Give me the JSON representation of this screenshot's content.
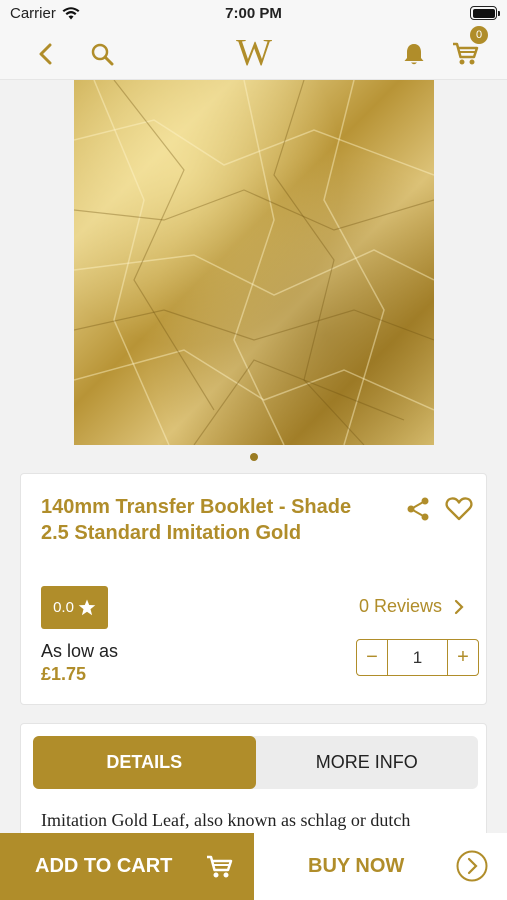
{
  "status_bar": {
    "carrier": "Carrier",
    "time": "7:00 PM"
  },
  "nav": {
    "logo": "W",
    "cart_count": "0",
    "icons": [
      "back-icon",
      "search-icon",
      "bell-icon",
      "cart-icon"
    ]
  },
  "colors": {
    "accent": "#b08d2a",
    "background": "#f2f2f2",
    "card": "#ffffff"
  },
  "product": {
    "title": "140mm Transfer Booklet - Shade 2.5 Standard Imitation Gold",
    "rating": "0.0",
    "reviews": "0 Reviews",
    "price_label": "As low as",
    "price": "£1.75",
    "quantity": "1",
    "carousel_count": 1,
    "carousel_index": 1
  },
  "tabs": [
    {
      "label": "DETAILS",
      "active": true
    },
    {
      "label": "MORE INFO",
      "active": false
    }
  ],
  "description": "Imitation Gold Leaf, also known as schlag or dutch",
  "actions": {
    "add_to_cart": "ADD TO CART",
    "buy_now": "BUY NOW"
  }
}
